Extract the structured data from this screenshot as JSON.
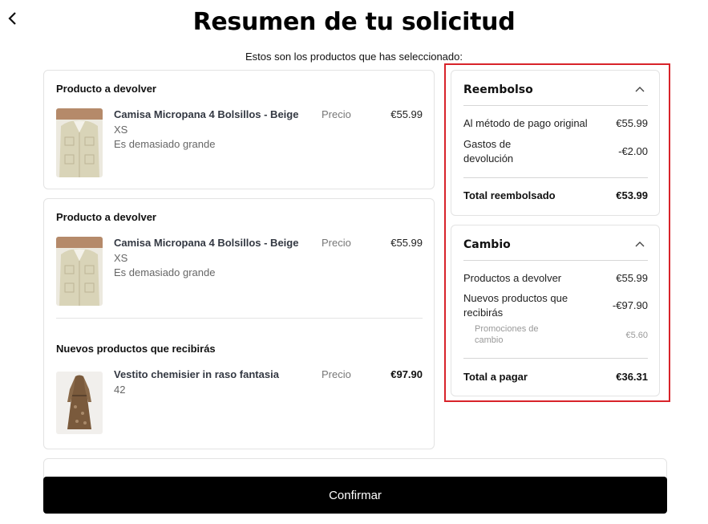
{
  "page": {
    "title": "Resumen de tu solicitud",
    "subtitle": "Estos son los productos que has seleccionado:"
  },
  "return_cards": [
    {
      "section_title": "Producto a devolver",
      "product": {
        "name": "Camisa Micropana 4 Bolsillos - Beige",
        "size": "XS",
        "reason": "Es demasiado grande",
        "price_label": "Precio",
        "price": "€55.99"
      }
    },
    {
      "section_title": "Producto a devolver",
      "product": {
        "name": "Camisa Micropana 4 Bolsillos - Beige",
        "size": "XS",
        "reason": "Es demasiado grande",
        "price_label": "Precio",
        "price": "€55.99"
      }
    }
  ],
  "new_products": {
    "section_title": "Nuevos productos que recibirás",
    "product": {
      "name": "Vestito chemisier in raso fantasia",
      "size": "42",
      "price_label": "Precio",
      "price": "€97.90"
    }
  },
  "refund": {
    "title": "Reembolso",
    "rows": [
      {
        "label": "Al método de pago original",
        "value": "€55.99"
      },
      {
        "label": "Gastos de devolución",
        "value": "-€2.00"
      }
    ],
    "total_label": "Total reembolsado",
    "total_value": "€53.99"
  },
  "exchange": {
    "title": "Cambio",
    "rows": [
      {
        "label": "Productos a devolver",
        "value": "€55.99"
      },
      {
        "label": "Nuevos productos que recibirás",
        "value": "-€97.90"
      }
    ],
    "promo_label": "Promociones de cambio",
    "promo_value": "€5.60",
    "total_label": "Total a pagar",
    "total_value": "€36.31"
  },
  "actions": {
    "confirm_label": "Confirmar"
  },
  "colors": {
    "highlight": "#d8232a",
    "button_bg": "#000000",
    "shirt": "#d9d4b8",
    "dress": "#7a5a3c"
  },
  "icons": {
    "back": "chevron-left-icon",
    "collapse": "chevron-up-icon"
  }
}
